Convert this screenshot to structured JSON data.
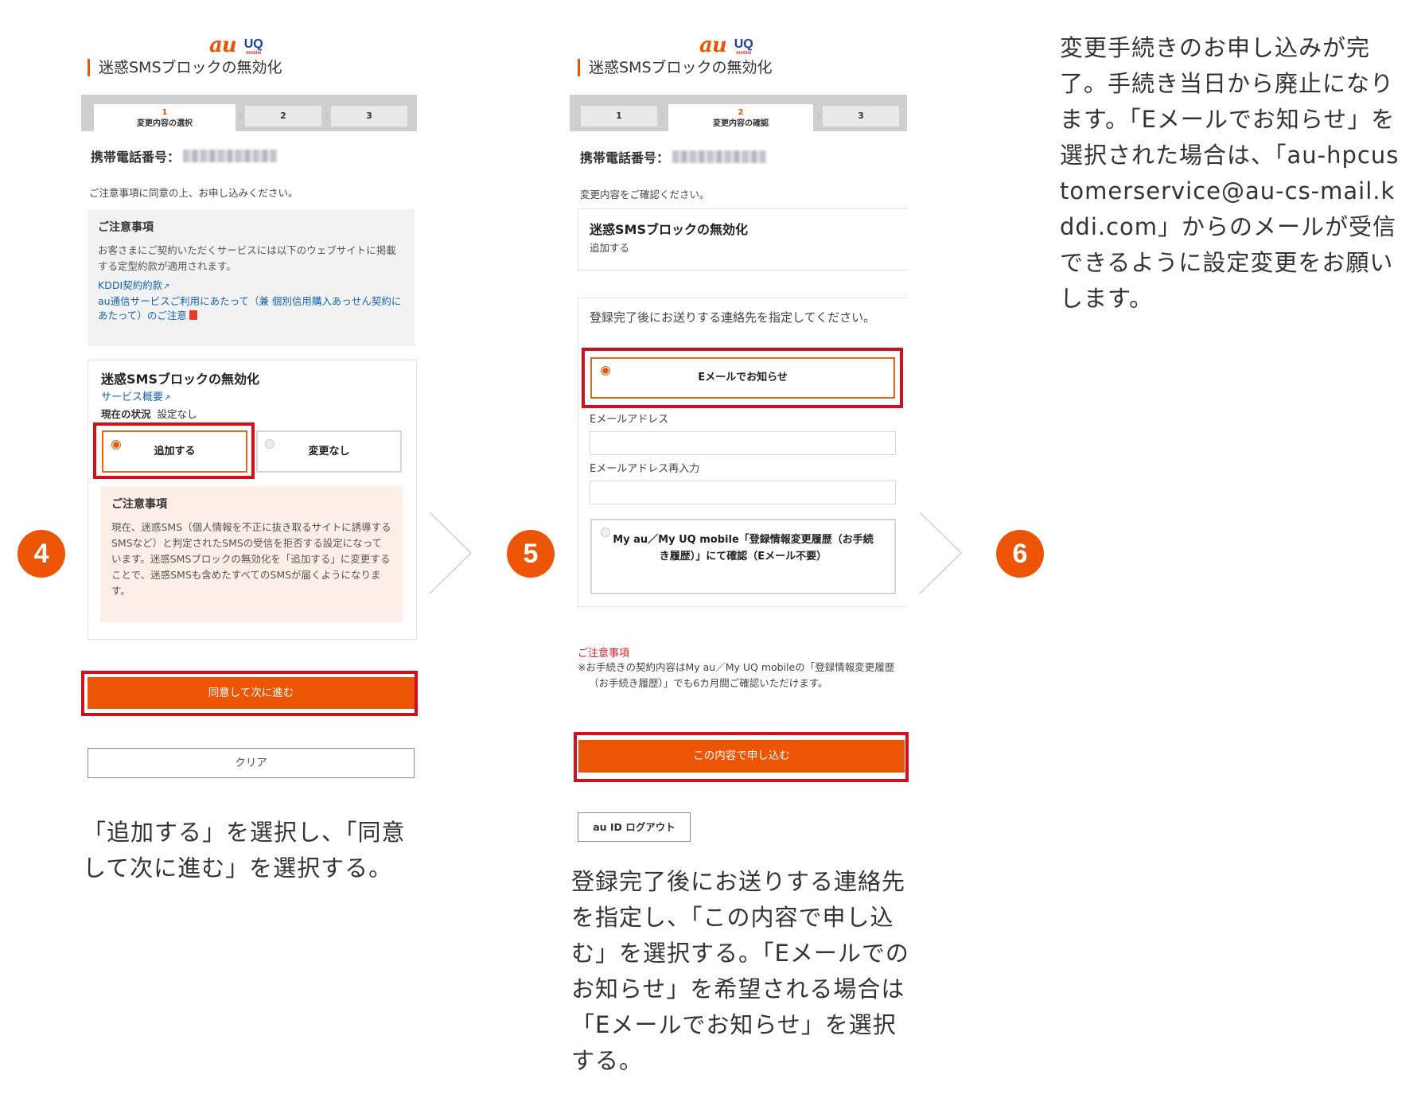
{
  "brand": {
    "au": "au",
    "uq": "UQ",
    "uq_sub": "mobile"
  },
  "colors": {
    "accent": "#eb5505",
    "highlight": "#d40f1d",
    "link": "#1465b5"
  },
  "badges": [
    "4",
    "5",
    "6"
  ],
  "panel4": {
    "title": "迷惑SMSブロックの無効化",
    "steps": [
      {
        "num": "1",
        "label": "変更内容の選択"
      },
      {
        "label": "2"
      },
      {
        "label": "3"
      }
    ],
    "phone_label": "携帯電話番号：",
    "intro": "ご注意事項に同意の上、お申し込みください。",
    "notice": {
      "heading": "ご注意事項",
      "text": "お客さまにご契約いただくサービスには以下のウェブサイトに掲載する定型約款が適用されます。",
      "link1": "KDDI契約約款",
      "link2": "au通信サービスご利用にあたって（兼 個別信用購入あっせん契約にあたって）のご注意"
    },
    "service": {
      "name": "迷惑SMSブロックの無効化",
      "overview_link": "サービス概要",
      "status_label": "現在の状況",
      "status_value": "設定なし",
      "option_add": "追加する",
      "option_none": "変更なし"
    },
    "warning": {
      "heading": "ご注意事項",
      "text": "現在、迷惑SMS（個人情報を不正に抜き取るサイトに誘導するSMSなど）と判定されたSMSの受信を拒否する設定になっています。迷惑SMSブロックの無効化を「追加する」に変更することで、迷惑SMSも含めたすべてのSMSが届くようになります。"
    },
    "btn_next": "同意して次に進む",
    "btn_clear": "クリア",
    "caption": "「追加する」を選択し、「同意して次に進む」を選択する。"
  },
  "panel5": {
    "title": "迷惑SMSブロックの無効化",
    "steps": [
      {
        "label": "1"
      },
      {
        "num": "2",
        "label": "変更内容の確認"
      },
      {
        "label": "3"
      }
    ],
    "phone_label": "携帯電話番号：",
    "intro": "変更内容をご確認ください。",
    "summary": {
      "name": "迷惑SMSブロックの無効化",
      "value": "追加する"
    },
    "contact": {
      "prompt": "登録完了後にお送りする連絡先を指定してください。",
      "option_email": "Eメールでお知らせ",
      "email_label": "Eメールアドレス",
      "email_value": "",
      "email_confirm_label": "Eメールアドレス再入力",
      "email_confirm_value": "",
      "option_myau": "My au／My UQ mobile「登録情報変更履歴（お手続き履歴）」にて確認（Eメール不要）"
    },
    "note": {
      "heading": "ご注意事項",
      "text": "※お手続きの契約内容はMy au／My UQ mobileの「登録情報変更履歴（お手続き履歴）」でも6カ月間ご確認いただけます。"
    },
    "btn_submit": "この内容で申し込む",
    "btn_logout": "au ID ログアウト",
    "caption": "登録完了後にお送りする連絡先を指定し、「この内容で申し込む」を選択する。「Eメールでのお知らせ」を希望される場合は「Eメールでお知らせ」を選択する。"
  },
  "panel6": {
    "caption": "変更手続きのお申し込みが完了。手続き当日から廃止になります。「Eメールでお知らせ」を選択された場合は、「au-hpcustomerservice@au-cs-mail.kddi.com」からのメールが受信できるように設定変更をお願いします。"
  }
}
